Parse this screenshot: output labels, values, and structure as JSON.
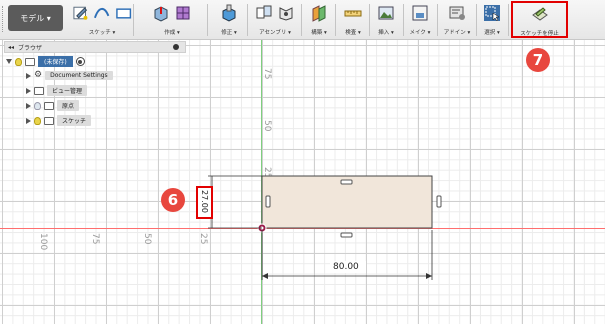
{
  "toolbar": {
    "mode_label": "モデル ▾",
    "groups": [
      {
        "label": "スケッチ ▾"
      },
      {
        "label": "作成 ▾"
      },
      {
        "label": "修正 ▾"
      },
      {
        "label": "アセンブリ ▾"
      },
      {
        "label": "構築 ▾"
      },
      {
        "label": "検査 ▾"
      },
      {
        "label": "挿入 ▾"
      },
      {
        "label": "メイク ▾"
      },
      {
        "label": "アドイン ▾"
      },
      {
        "label": "選択 ▾"
      },
      {
        "label": "スケッチを停止"
      }
    ]
  },
  "browser": {
    "title": "ブラウザ",
    "root_label": "(未保存)",
    "items": [
      {
        "label": "Document Settings",
        "icon": "gear-icon"
      },
      {
        "label": "ビュー管理",
        "icon": "folder-icon"
      },
      {
        "label": "原点",
        "icon": "folder-icon"
      },
      {
        "label": "スケッチ",
        "icon": "folder-icon"
      }
    ]
  },
  "canvas": {
    "vertical_ticks": [
      "75",
      "50",
      "25"
    ],
    "horizontal_ticks": [
      "100",
      "75",
      "50",
      "25"
    ],
    "dim_width": "80.00",
    "dim_height": "27.00"
  },
  "annotations": {
    "step6": "6",
    "step7": "7"
  },
  "colors": {
    "rectangle_fill": "#f1e6da",
    "highlight": "#e20000",
    "badge": "#e8473e",
    "x_axis": "#ff6e6e",
    "y_axis": "#7fcf7f"
  }
}
